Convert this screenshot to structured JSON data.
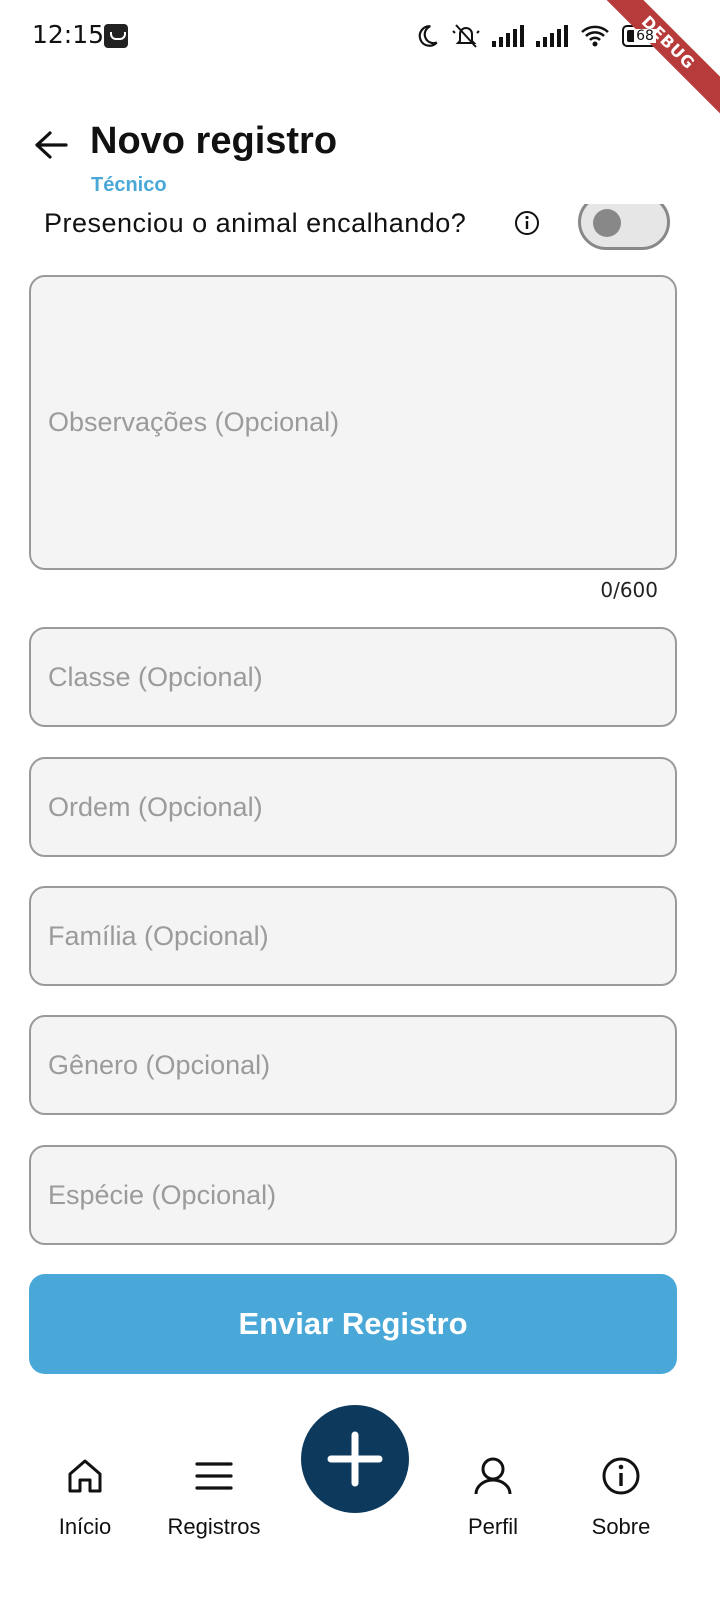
{
  "status_bar": {
    "time": "12:15",
    "battery": "68",
    "debug_label": "DEBUG"
  },
  "header": {
    "title": "Novo registro",
    "subtitle": "Técnico"
  },
  "toggle": {
    "label": "Presenciou o animal encalhando?",
    "on": false
  },
  "form": {
    "observacoes_placeholder": "Observações (Opcional)",
    "observacoes_counter": "0/600",
    "classe_placeholder": "Classe (Opcional)",
    "ordem_placeholder": "Ordem (Opcional)",
    "familia_placeholder": "Família (Opcional)",
    "genero_placeholder": "Gênero (Opcional)",
    "especie_placeholder": "Espécie (Opcional)",
    "submit_label": "Enviar Registro"
  },
  "nav": {
    "items": [
      {
        "label": "Início",
        "icon": "home-icon"
      },
      {
        "label": "Registros",
        "icon": "menu-icon"
      },
      {
        "label": "Perfil",
        "icon": "person-icon"
      },
      {
        "label": "Sobre",
        "icon": "info-icon"
      }
    ],
    "fab_icon": "plus-icon"
  },
  "colors": {
    "accent": "#49a8d8",
    "fab": "#0d3a5c",
    "field_bg": "#f4f4f4",
    "field_border": "#9a9a9a"
  }
}
